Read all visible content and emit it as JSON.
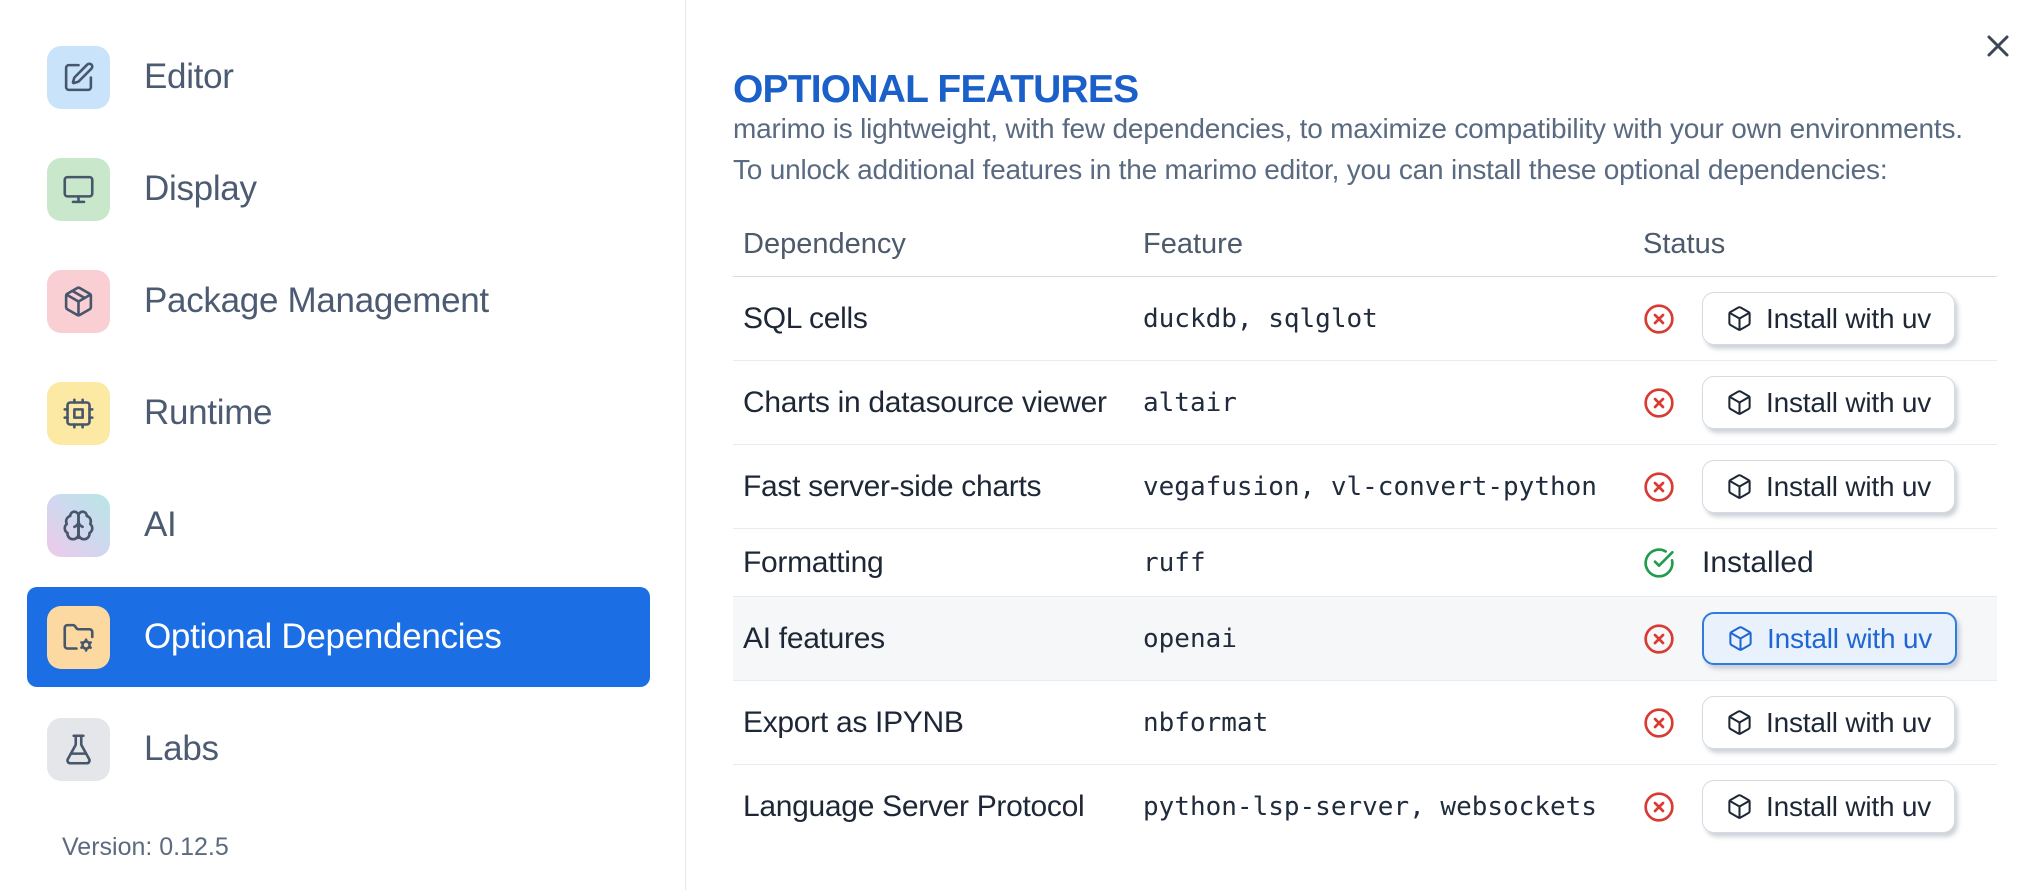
{
  "sidebar": {
    "items": [
      {
        "label": "Editor",
        "icon": "square-pen-icon",
        "selected": false
      },
      {
        "label": "Display",
        "icon": "monitor-icon",
        "selected": false
      },
      {
        "label": "Package Management",
        "icon": "package-icon",
        "selected": false
      },
      {
        "label": "Runtime",
        "icon": "cpu-icon",
        "selected": false
      },
      {
        "label": "AI",
        "icon": "brain-icon",
        "selected": false
      },
      {
        "label": "Optional Dependencies",
        "icon": "folder-cog-icon",
        "selected": true
      },
      {
        "label": "Labs",
        "icon": "flask-icon",
        "selected": false
      }
    ],
    "version_label": "Version: 0.12.5"
  },
  "dialog": {
    "title": "OPTIONAL FEATURES",
    "description_line1": "marimo is lightweight, with few dependencies, to maximize compatibility with your own environments.",
    "description_line2": "To unlock additional features in the marimo editor, you can install these optional dependencies:",
    "close_icon": "x-icon"
  },
  "table": {
    "headers": {
      "dependency": "Dependency",
      "feature": "Feature",
      "status": "Status"
    },
    "rows": [
      {
        "dependency": "SQL cells",
        "feature": "duckdb, sqlglot",
        "status": "not_installed",
        "action_label": "Install with uv"
      },
      {
        "dependency": "Charts in datasource viewer",
        "feature": "altair",
        "status": "not_installed",
        "action_label": "Install with uv"
      },
      {
        "dependency": "Fast server-side charts",
        "feature": "vegafusion, vl-convert-python",
        "status": "not_installed",
        "action_label": "Install with uv"
      },
      {
        "dependency": "Formatting",
        "feature": "ruff",
        "status": "installed",
        "status_label": "Installed"
      },
      {
        "dependency": "AI features",
        "feature": "openai",
        "status": "not_installed",
        "action_label": "Install with uv",
        "focused": true
      },
      {
        "dependency": "Export as IPYNB",
        "feature": "nbformat",
        "status": "not_installed",
        "action_label": "Install with uv"
      },
      {
        "dependency": "Language Server Protocol",
        "feature": "python-lsp-server, websockets",
        "status": "not_installed",
        "action_label": "Install with uv"
      }
    ]
  },
  "colors": {
    "selected_item_blue": "#1b6ee4",
    "title_blue": "#1b5fc8",
    "error_red": "#d93a31",
    "success_green": "#1f9d4d",
    "focus_button_border": "#2e7ce0",
    "focus_button_bg": "#e9f1fd",
    "icon_bg_editor": "#c9e4fa",
    "icon_bg_display": "#c9e7cb",
    "icon_bg_packages": "#facfd3",
    "icon_bg_runtime": "#fbe9a4",
    "icon_bg_optional_deps": "#fbd9a0",
    "icon_bg_labs": "#e5e6ea"
  }
}
